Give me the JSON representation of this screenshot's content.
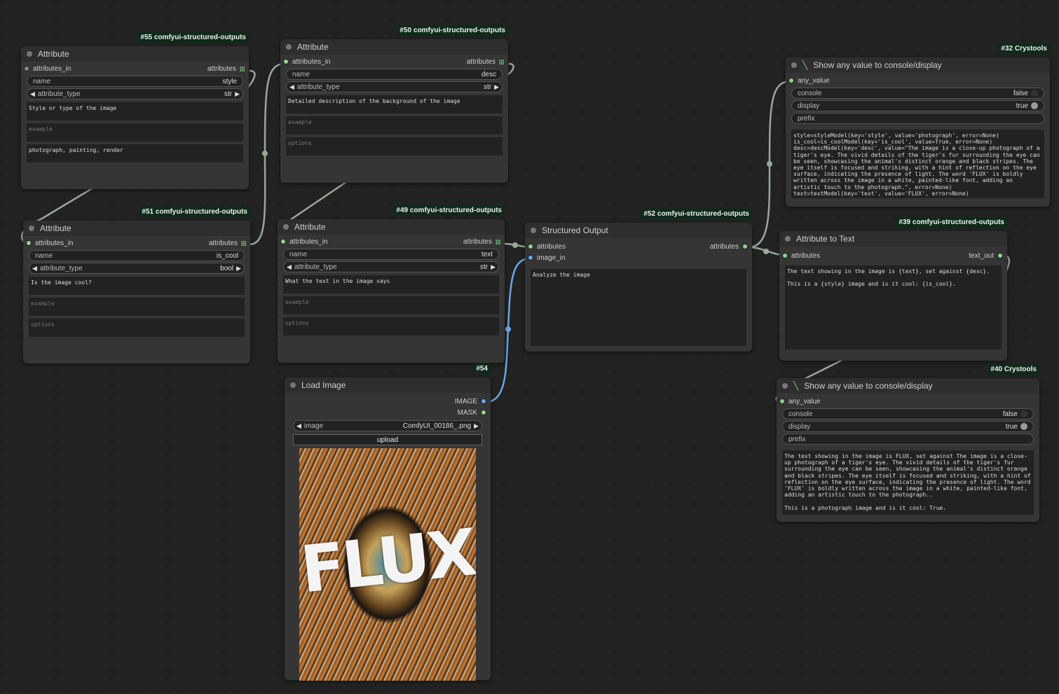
{
  "colors": {
    "canvas": "#222222",
    "node": "#353535",
    "header": "#2e2e2e",
    "badge": "#0e2a1a",
    "slot_green": "#8fd48f",
    "slot_blue": "#6aa6e8",
    "link": "#9aa89a",
    "link_blue": "#6aa6e8"
  },
  "nodes": {
    "n55": {
      "badge": "#55 comfyui-structured-outputs",
      "title": "Attribute",
      "input": "attributes_in",
      "output": "attributes",
      "name_label": "name",
      "name_value": "style",
      "type_label": "attribute_type",
      "type_value": "str",
      "description": "Style or type of the image",
      "example_ph": "example",
      "options": "photograph, painting, render"
    },
    "n50": {
      "badge": "#50 comfyui-structured-outputs",
      "title": "Attribute",
      "input": "attributes_in",
      "output": "attributes",
      "name_label": "name",
      "name_value": "desc",
      "type_label": "attribute_type",
      "type_value": "str",
      "description": "Detailed description of the background of the image",
      "example_ph": "example",
      "options_ph": "options"
    },
    "n51": {
      "badge": "#51 comfyui-structured-outputs",
      "title": "Attribute",
      "input": "attributes_in",
      "output": "attributes",
      "name_label": "name",
      "name_value": "is_cool",
      "type_label": "attribute_type",
      "type_value": "bool",
      "description": "Is the image cool?",
      "example_ph": "example",
      "options_ph": "options"
    },
    "n49": {
      "badge": "#49 comfyui-structured-outputs",
      "title": "Attribute",
      "input": "attributes_in",
      "output": "attributes",
      "name_label": "name",
      "name_value": "text",
      "type_label": "attribute_type",
      "type_value": "str",
      "description": "What the text in the image says",
      "example_ph": "example",
      "options_ph": "options"
    },
    "n52": {
      "badge": "#52 comfyui-structured-outputs",
      "title": "Structured Output",
      "input1": "attributes",
      "input2": "image_in",
      "output": "attributes",
      "prompt": "Analyze the image"
    },
    "n54": {
      "badge": "#54",
      "title": "Load Image",
      "output1": "IMAGE",
      "output2": "MASK",
      "image_label": "image",
      "image_value": "ComfyUI_00186_.png",
      "upload": "upload",
      "image_text": "FLUX"
    },
    "n32": {
      "badge": "#32 Crystools",
      "title": "Show any value to console/display",
      "input": "any_value",
      "console_label": "console",
      "console_value": "false",
      "display_label": "display",
      "display_value": "true",
      "prefix_label": "prefix",
      "output_text": "style=styleModel(key='style', value='photograph', error=None)\nis_cool=is_coolModel(key='is_cool', value=True, error=None)\ndesc=descModel(key='desc', value=\"The image is a close-up photograph of a tiger's eye. The vivid details of the tiger's fur surrounding the eye can be seen, showcasing the animal's distinct orange and black stripes. The eye itself is focused and striking, with a hint of reflection on the eye surface, indicating the presence of light. The word 'FLUX' is boldly written across the image in a white, painted-like font, adding an artistic touch to the photograph.\", error=None)\ntext=textModel(key='text', value='FLUX', error=None)"
    },
    "n39": {
      "badge": "#39 comfyui-structured-outputs",
      "title": "Attribute to Text",
      "input": "attributes",
      "output": "text_out",
      "template": "The text showing in the image is {text}, set against {desc}.\n\nThis is a {style} image and is it cool: {is_cool}."
    },
    "n40": {
      "badge": "#40 Crystools",
      "title": "Show any value to console/display",
      "input": "any_value",
      "console_label": "console",
      "console_value": "false",
      "display_label": "display",
      "display_value": "true",
      "prefix_label": "prefix",
      "output_text": "The text showing in the image is FLUX, set against The image is a close-up photograph of a tiger's eye. The vivid details of the tiger's fur surrounding the eye can be seen, showcasing the animal's distinct orange and black stripes. The eye itself is focused and striking, with a hint of reflection on the eye surface, indicating the presence of light. The word 'FLUX' is boldly written across the image in a white, painted-like font, adding an artistic touch to the photograph..\n\nThis is a photograph image and is it cool: True."
    }
  }
}
